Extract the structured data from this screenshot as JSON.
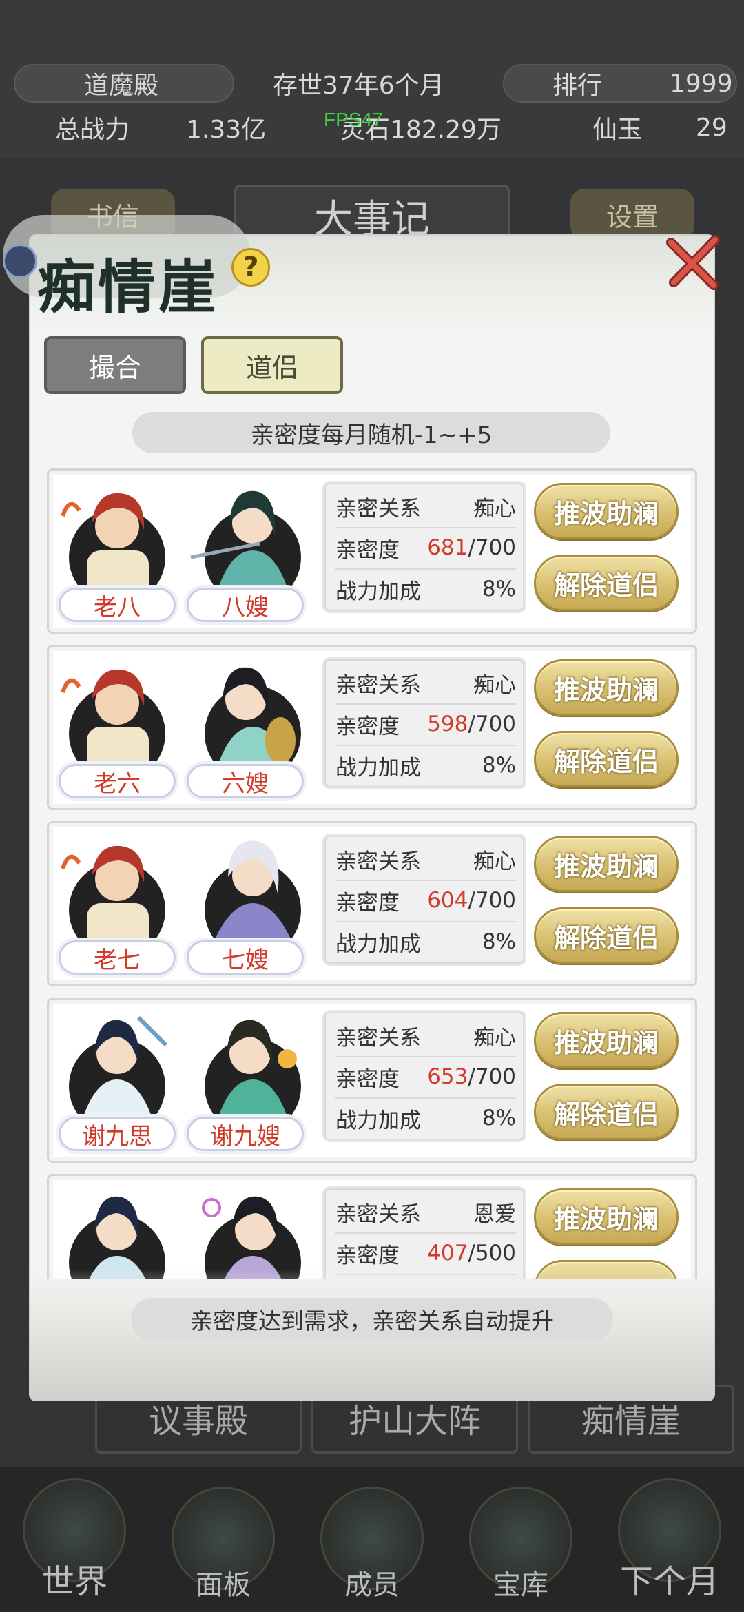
{
  "top_stats": {
    "sect_name": "道魔殿",
    "age": "存世37年6个月",
    "rank_label": "排行",
    "rank_value": "1999",
    "power_label": "总战力",
    "power_value": "1.33亿",
    "stone_value": "灵石182.29万",
    "jade_label": "仙玉",
    "jade_value": "29",
    "fps": "FPS47"
  },
  "background": {
    "title": "大事记",
    "left_btn": "书信",
    "settings_btn": "设置",
    "halls": [
      "议事殿",
      "护山大阵",
      "痴情崖"
    ]
  },
  "bottom_nav": [
    {
      "label": "世界",
      "icon": "world-icon"
    },
    {
      "label": "面板",
      "icon": "panel-icon"
    },
    {
      "label": "成员",
      "icon": "members-icon"
    },
    {
      "label": "宝库",
      "icon": "treasury-icon"
    },
    {
      "label": "下个月",
      "icon": "next-month-icon"
    }
  ],
  "modal": {
    "title": "痴情崖",
    "tabs": {
      "match": "撮合",
      "partner": "道侣"
    },
    "info": "亲密度每月随机-1~+5",
    "footer": "亲密度达到需求，亲密关系自动提升",
    "labels": {
      "relation": "亲密关系",
      "affinity": "亲密度",
      "bonus": "战力加成",
      "btn_help": "推波助澜",
      "btn_dissolve": "解除道侣"
    },
    "pairs": [
      {
        "male": "老八",
        "female": "八嫂",
        "relation": "痴心",
        "affinity": "681",
        "affinity_max": "/700",
        "bonus": "8%",
        "male_hair": "#b5382a",
        "female_hair": "#1f3a34",
        "female_robe": "#5fb3a8"
      },
      {
        "male": "老六",
        "female": "六嫂",
        "relation": "痴心",
        "affinity": "598",
        "affinity_max": "/700",
        "bonus": "8%",
        "male_hair": "#b5382a",
        "female_hair": "#1d1d24",
        "female_robe": "#8fd2c7"
      },
      {
        "male": "老七",
        "female": "七嫂",
        "relation": "痴心",
        "affinity": "604",
        "affinity_max": "/700",
        "bonus": "8%",
        "male_hair": "#b5382a",
        "female_hair": "#e6e6ee",
        "female_robe": "#8a86c9"
      },
      {
        "male": "谢九思",
        "female": "谢九嫂",
        "relation": "痴心",
        "affinity": "653",
        "affinity_max": "/700",
        "bonus": "8%",
        "male_hair": "#1e2a44",
        "female_hair": "#2a2a20",
        "female_robe": "#4fb39a"
      },
      {
        "male": "",
        "female": "",
        "relation": "恩爱",
        "affinity": "407",
        "affinity_max": "/500",
        "bonus": "",
        "male_hair": "#1e2a44",
        "female_hair": "#1d1d24",
        "female_robe": "#b8a6d8"
      }
    ]
  }
}
